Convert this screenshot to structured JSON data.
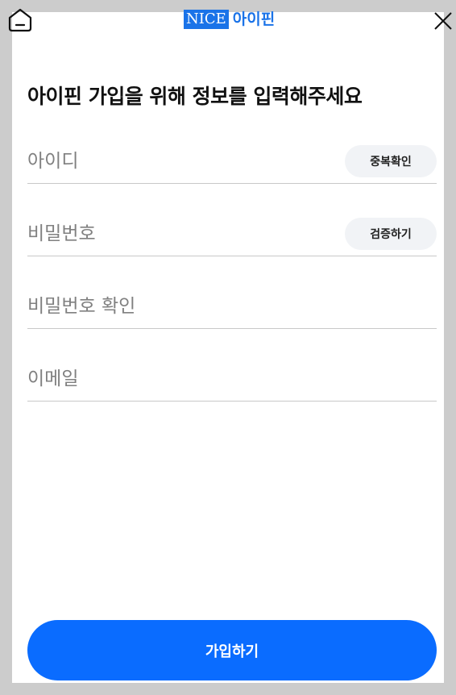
{
  "header": {
    "logo_box_text": "NICE",
    "logo_text": "아이핀",
    "home_icon": "home-icon",
    "close_icon": "close-icon"
  },
  "form": {
    "title": "아이핀 가입을 위해 정보를 입력해주세요",
    "fields": [
      {
        "placeholder": "아이디",
        "value": "",
        "action_label": "중복확인"
      },
      {
        "placeholder": "비밀번호",
        "value": "",
        "action_label": "검증하기"
      },
      {
        "placeholder": "비밀번호 확인",
        "value": ""
      },
      {
        "placeholder": "이메일",
        "value": ""
      }
    ],
    "submit_label": "가입하기"
  },
  "colors": {
    "accent": "#0a6cff",
    "logo_blue": "#1a73e8",
    "backdrop": "#cccccc"
  }
}
